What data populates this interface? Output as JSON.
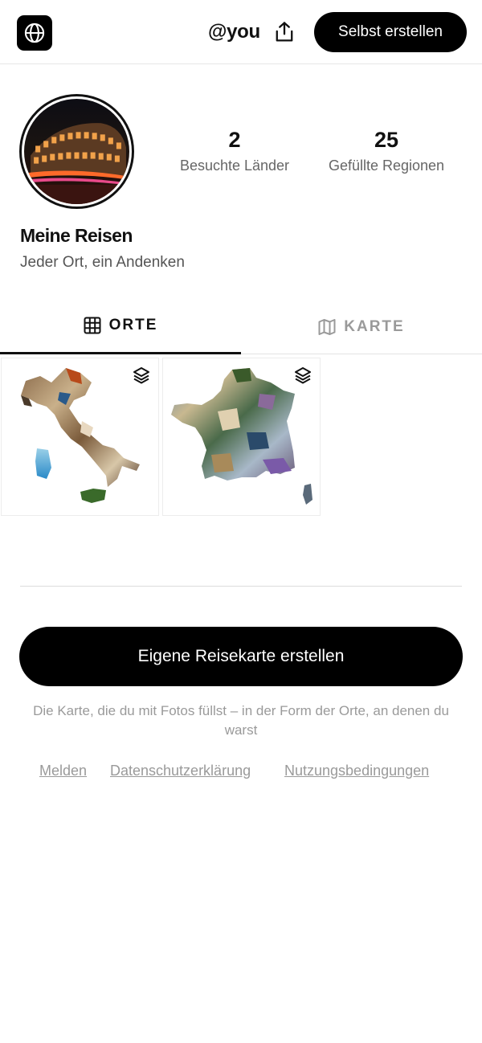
{
  "header": {
    "handle": "@you",
    "create_button": "Selbst erstellen"
  },
  "profile": {
    "stats": [
      {
        "value": "2",
        "label": "Besuchte Länder"
      },
      {
        "value": "25",
        "label": "Gefüllte Regionen"
      }
    ],
    "title": "Meine Reisen",
    "subtitle": "Jeder Ort, ein Andenken"
  },
  "tabs": [
    {
      "label": "ORTE",
      "icon": "grid-icon",
      "active": true
    },
    {
      "label": "KARTE",
      "icon": "map-icon",
      "active": false
    }
  ],
  "grid": {
    "items": [
      {
        "name": "italy-map",
        "icon": "layers-icon"
      },
      {
        "name": "france-map",
        "icon": "layers-icon"
      }
    ]
  },
  "cta": {
    "button": "Eigene Reisekarte erstellen",
    "tagline": "Die Karte, die du mit Fotos füllst – in der Form der Orte, an denen du warst"
  },
  "footer": {
    "links": [
      "Melden",
      "Datenschutzerklärung",
      "Nutzungsbedingungen"
    ]
  },
  "colors": {
    "primary": "#000000",
    "muted_text": "#9a9a9a",
    "border": "#e6e6e6"
  }
}
